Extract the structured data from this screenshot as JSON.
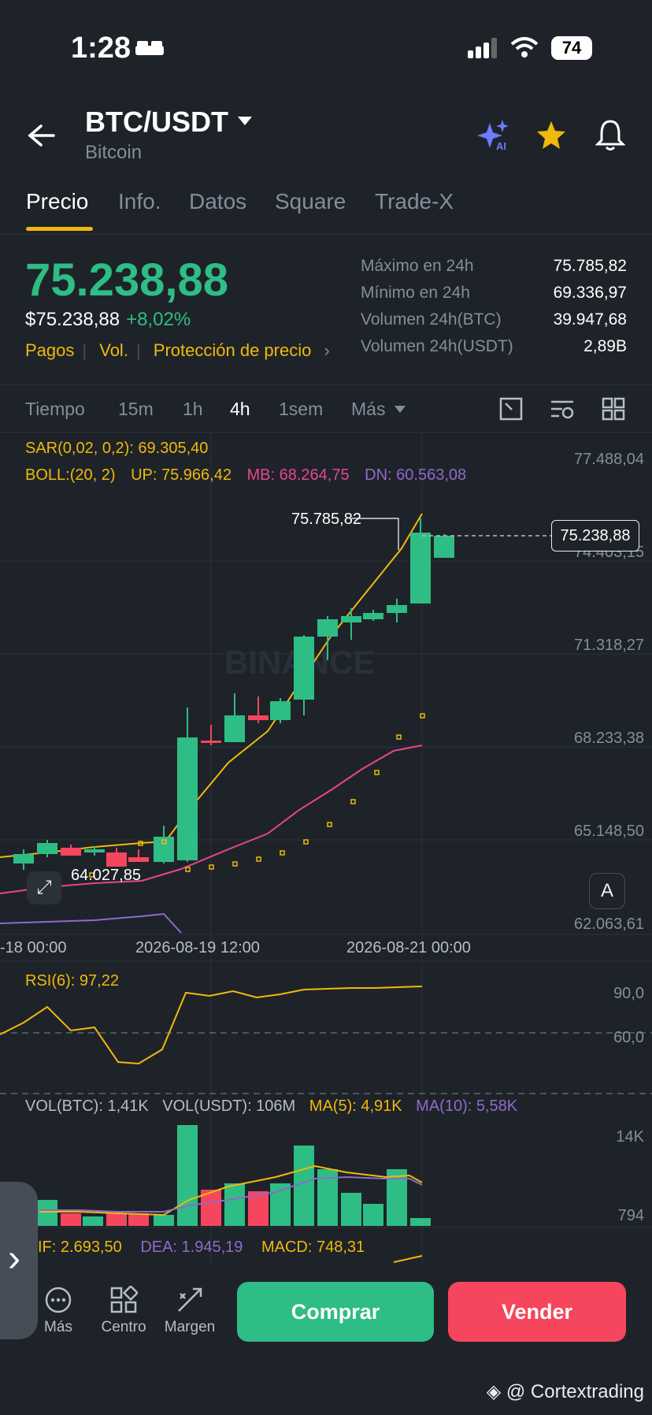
{
  "status": {
    "time": "1:28",
    "battery": "74"
  },
  "header": {
    "pair": "BTC/USDT",
    "subtitle": "Bitcoin"
  },
  "tabs": [
    "Precio",
    "Info.",
    "Datos",
    "Square",
    "Trade-X"
  ],
  "ticker": {
    "price": "75.238,88",
    "price_usd": "$75.238,88",
    "change": "+8,02%",
    "links": [
      "Pagos",
      "Vol.",
      "Protección de precio"
    ],
    "stats": [
      {
        "k": "Máximo en 24h",
        "v": "75.785,82"
      },
      {
        "k": "Mínimo en 24h",
        "v": "69.336,97"
      },
      {
        "k": "Volumen 24h(BTC)",
        "v": "39.947,68"
      },
      {
        "k": "Volumen 24h(USDT)",
        "v": "2,89B"
      }
    ]
  },
  "intervals": [
    "Tiempo",
    "15m",
    "1h",
    "4h",
    "1sem",
    "Más"
  ],
  "indicators": {
    "sar": "SAR(0,02, 0,2): 69.305,40",
    "boll": "BOLL:(20, 2)",
    "up": "UP: 75.966,42",
    "mb": "MB: 68.264,75",
    "dn": "DN: 60.563,08"
  },
  "price_axis": [
    "77.488,04",
    "74.403,15",
    "71.318,27",
    "68.233,38",
    "65.148,50",
    "62.063,61"
  ],
  "current_price_tag": "75.238,88",
  "high_label": "75.785,82",
  "low_label": "64.027,85",
  "time_axis": [
    "-18 00:00",
    "2026-08-19 12:00",
    "2026-08-21 00:00"
  ],
  "rsi": {
    "label": "RSI(6): 97,22",
    "axis": [
      "90,0",
      "60,0"
    ]
  },
  "vol": {
    "vbtc": "VOL(BTC): 1,41K",
    "vusdt": "VOL(USDT): 106M",
    "ma5": "MA(5): 4,91K",
    "ma10": "MA(10): 5,58K",
    "axis": [
      "14K",
      "794"
    ]
  },
  "macd": {
    "dif": "IF: 2.693,50",
    "dea": "DEA: 1.945,19",
    "macd": "MACD: 748,31"
  },
  "bottom": {
    "icons": [
      "Más",
      "Centro",
      "Margen"
    ],
    "buy": "Comprar",
    "sell": "Vender"
  },
  "watermark": "@ Cortextrading",
  "chart_watermark": "BINANCE",
  "colors": {
    "up": "#2ebd85",
    "down": "#f6465d",
    "accent": "#f0b90b",
    "bg": "#1e2329"
  }
}
